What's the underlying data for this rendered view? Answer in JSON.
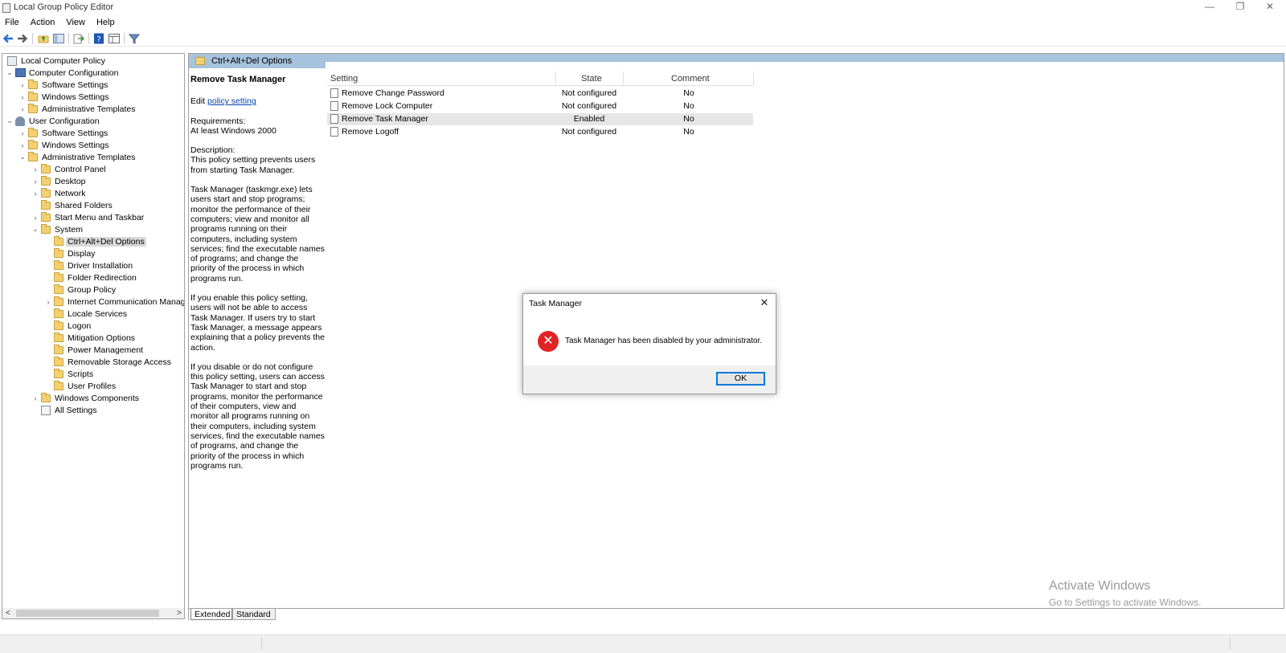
{
  "window": {
    "title": "Local Group Policy Editor",
    "minimize": "—",
    "restore": "❐",
    "close": "✕"
  },
  "menu": [
    "File",
    "Action",
    "View",
    "Help"
  ],
  "toolbar": {
    "icons": [
      "back-arrow-icon",
      "forward-arrow-icon",
      "up-folder-icon",
      "show-hide-tree-icon",
      "export-list-icon",
      "help-icon",
      "properties-icon",
      "filter-icon"
    ]
  },
  "tree": {
    "root": "Local Computer Policy",
    "computer_configuration": "Computer Configuration",
    "software_settings": "Software Settings",
    "windows_settings": "Windows Settings",
    "administrative_templates": "Administrative Templates",
    "user_configuration": "User Configuration",
    "control_panel": "Control Panel",
    "desktop": "Desktop",
    "network": "Network",
    "shared_folders": "Shared Folders",
    "start_menu": "Start Menu and Taskbar",
    "system": "System",
    "ctrl_alt_del": "Ctrl+Alt+Del Options",
    "display": "Display",
    "driver_installation": "Driver Installation",
    "folder_redirection": "Folder Redirection",
    "group_policy": "Group Policy",
    "internet_communication": "Internet Communication Manag",
    "locale_services": "Locale Services",
    "logon": "Logon",
    "mitigation_options": "Mitigation Options",
    "power_management": "Power Management",
    "removable_storage": "Removable Storage Access",
    "scripts": "Scripts",
    "user_profiles": "User Profiles",
    "windows_components": "Windows Components",
    "all_settings": "All Settings"
  },
  "right": {
    "path_title": "Ctrl+Alt+Del Options",
    "description": {
      "heading": "Remove Task Manager",
      "edit_prefix": "Edit ",
      "edit_link": "policy setting",
      "req_label": "Requirements:",
      "req_value": "At least Windows 2000",
      "desc_label": "Description:",
      "desc_1": "This policy setting prevents users from starting Task Manager.",
      "desc_2": "Task Manager (taskmgr.exe) lets users start and stop programs; monitor the performance of their computers; view and monitor all programs running on their computers, including system services; find the executable names of programs; and change the priority of the process in which programs run.",
      "desc_3": "If you enable this policy setting, users will not be able to access Task Manager. If users try to start Task Manager, a message appears explaining that a policy prevents the action.",
      "desc_4": "If you disable or do not configure this policy setting, users can access Task Manager to  start and stop programs, monitor the performance of their computers, view and monitor all programs running on their computers, including system services, find the executable names of programs, and change the priority of the process in which programs run."
    },
    "columns": {
      "setting": "Setting",
      "state": "State",
      "comment": "Comment"
    },
    "rows": [
      {
        "name": "Remove Change Password",
        "state": "Not configured",
        "comment": "No"
      },
      {
        "name": "Remove Lock Computer",
        "state": "Not configured",
        "comment": "No"
      },
      {
        "name": "Remove Task Manager",
        "state": "Enabled",
        "comment": "No"
      },
      {
        "name": "Remove Logoff",
        "state": "Not configured",
        "comment": "No"
      }
    ],
    "watermark_title": "Activate Windows",
    "watermark_sub": "Go to Settings to activate Windows."
  },
  "tabs": {
    "extended": "Extended",
    "standard": "Standard"
  },
  "dialog": {
    "title": "Task Manager",
    "close": "✕",
    "message": "Task Manager has been disabled by your administrator.",
    "ok": "OK",
    "icon_glyph": "✕"
  },
  "scroll": {
    "left": "<",
    "right": ">"
  },
  "chevrons": {
    "open": "⌄",
    "closed": "›"
  }
}
